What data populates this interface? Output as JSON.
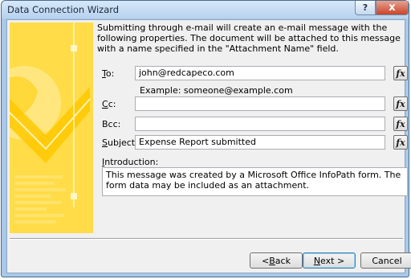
{
  "window": {
    "title": "Data Connection Wizard"
  },
  "titlebar_buttons": {
    "help": "?",
    "close": "x"
  },
  "description": "Submitting through e-mail will create an e-mail message with the following properties. The document will be attached to this message with a name specified in the \"Attachment Name\" field.",
  "fields": {
    "to": {
      "label_key": "T",
      "label_rest": "o:",
      "value": "john@redcapeco.com",
      "example": "Example: someone@example.com"
    },
    "cc": {
      "label_key": "C",
      "label_rest": "c:",
      "value": ""
    },
    "bcc": {
      "label": "Bcc:",
      "value": ""
    },
    "subject": {
      "label_key": "S",
      "label_rest": "ubject:",
      "value": "Expense Report submitted"
    },
    "fx_label": "fx"
  },
  "introduction": {
    "label_key": "I",
    "label_rest": "ntroduction:",
    "value": "This message was created by a Microsoft Office InfoPath form. The form data may be included as an attachment."
  },
  "buttons": {
    "back_prefix": "< ",
    "back_key": "B",
    "back_rest": "ack",
    "next_key": "N",
    "next_rest": "ext >",
    "cancel": "Cancel"
  },
  "colors": {
    "art_yellow": "#ffd93a",
    "window_border": "#a9c9ea",
    "close_red": "#c9452a"
  }
}
